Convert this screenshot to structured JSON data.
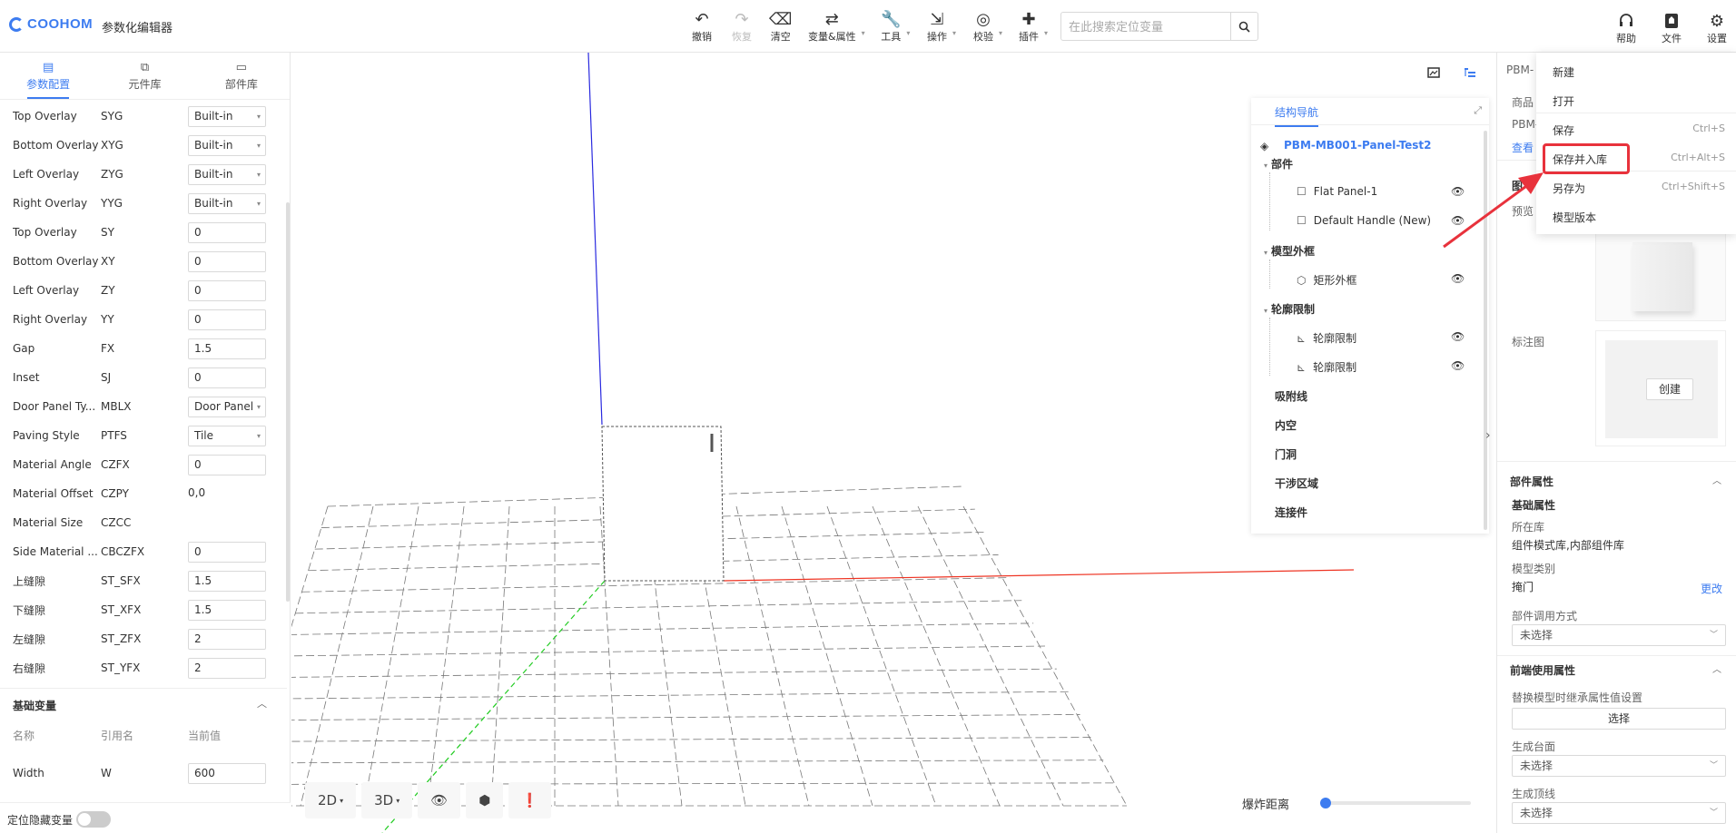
{
  "app": {
    "logo_text": "COOHOM",
    "title": "参数化编辑器"
  },
  "toolbar": {
    "items": [
      {
        "label": "撤销",
        "icon": "undo-icon"
      },
      {
        "label": "恢复",
        "icon": "redo-icon"
      },
      {
        "label": "清空",
        "icon": "eraser-icon"
      },
      {
        "label": "变量&属性",
        "icon": "variable-icon"
      },
      {
        "label": "工具",
        "icon": "wrench-icon"
      },
      {
        "label": "操作",
        "icon": "operate-icon"
      },
      {
        "label": "校验",
        "icon": "check-icon"
      },
      {
        "label": "插件",
        "icon": "plugin-icon"
      }
    ],
    "search_placeholder": "在此搜索定位变量",
    "right": [
      {
        "label": "帮助",
        "icon": "headset-icon"
      },
      {
        "label": "文件",
        "icon": "file-icon"
      },
      {
        "label": "设置",
        "icon": "gear-icon"
      }
    ]
  },
  "left_tabs": [
    {
      "label": "参数配置",
      "icon": "param-icon"
    },
    {
      "label": "元件库",
      "icon": "component-icon"
    },
    {
      "label": "部件库",
      "icon": "part-library-icon"
    }
  ],
  "params": [
    {
      "name": "Top Overlay",
      "code": "SYG",
      "value": "Built-in",
      "type": "select"
    },
    {
      "name": "Bottom Overlay",
      "code": "XYG",
      "value": "Built-in",
      "type": "select"
    },
    {
      "name": "Left Overlay",
      "code": "ZYG",
      "value": "Built-in",
      "type": "select"
    },
    {
      "name": "Right Overlay",
      "code": "YYG",
      "value": "Built-in",
      "type": "select"
    },
    {
      "name": "Top Overlay",
      "code": "SY",
      "value": "0",
      "type": "input"
    },
    {
      "name": "Bottom Overlay",
      "code": "XY",
      "value": "0",
      "type": "input"
    },
    {
      "name": "Left Overlay",
      "code": "ZY",
      "value": "0",
      "type": "input"
    },
    {
      "name": "Right Overlay",
      "code": "YY",
      "value": "0",
      "type": "input"
    },
    {
      "name": "Gap",
      "code": "FX",
      "value": "1.5",
      "type": "input"
    },
    {
      "name": "Inset",
      "code": "SJ",
      "value": "0",
      "type": "input"
    },
    {
      "name": "Door Panel Ty...",
      "code": "MBLX",
      "value": "Door Panel",
      "type": "select"
    },
    {
      "name": "Paving Style",
      "code": "PTFS",
      "value": "Tile",
      "type": "select"
    },
    {
      "name": "Material Angle",
      "code": "CZFX",
      "value": "0",
      "type": "input"
    },
    {
      "name": "Material Offset",
      "code": "CZPY",
      "value": "0,0",
      "type": "plain"
    },
    {
      "name": "Material Size",
      "code": "CZCC",
      "value": "",
      "type": "plain"
    },
    {
      "name": "Side Material ...",
      "code": "CBCZFX",
      "value": "0",
      "type": "input"
    },
    {
      "name": "上缝隙",
      "code": "ST_SFX",
      "value": "1.5",
      "type": "input"
    },
    {
      "name": "下缝隙",
      "code": "ST_XFX",
      "value": "1.5",
      "type": "input"
    },
    {
      "name": "左缝隙",
      "code": "ST_ZFX",
      "value": "2",
      "type": "input"
    },
    {
      "name": "右缝隙",
      "code": "ST_YFX",
      "value": "2",
      "type": "input"
    }
  ],
  "basic_vars": {
    "title": "基础变量",
    "headers": [
      "名称",
      "引用名",
      "当前值"
    ],
    "rows": [
      {
        "name": "Width",
        "code": "W",
        "value": "600"
      }
    ]
  },
  "hide_toggle_label": "定位隐藏变量",
  "viewport": {
    "bottom_buttons": [
      "2D",
      "3D"
    ],
    "explode_label": "爆炸距离",
    "explode_value": 0
  },
  "structure_nav": {
    "title": "结构导航",
    "root": "PBM-MB001-Panel-Test2",
    "groups": [
      {
        "label": "部件",
        "children": [
          "Flat Panel-1",
          "Default Handle (New)"
        ]
      },
      {
        "label": "模型外框",
        "children": [
          "矩形外框"
        ]
      },
      {
        "label": "轮廓限制",
        "children": [
          "轮廓限制",
          "轮廓限制"
        ]
      }
    ],
    "others": [
      "吸附线",
      "内空",
      "门洞",
      "干涉区域",
      "连接件"
    ]
  },
  "right_panel": {
    "code_prefix": "PBM-",
    "product_label": "商品",
    "product_prefix": "PBM-",
    "view_link": "查看",
    "section_prefix": "图",
    "preview_label": "预览",
    "label_image": "标注图",
    "create_button": "创建",
    "part_props_title": "部件属性",
    "basic_props": "基础属性",
    "library_label": "所在库",
    "library_value": "组件模式库,内部组件库",
    "model_type_label": "模型类别",
    "model_type_value": "掩门",
    "change_link": "更改",
    "call_mode_label": "部件调用方式",
    "call_mode_value": "未选择",
    "frontend_title": "前端使用属性",
    "inherit_label": "替换模型时继承属性值设置",
    "select_button": "选择",
    "gen_top_label": "生成台面",
    "gen_top_value": "未选择",
    "gen_line_label": "生成顶线",
    "gen_line_value": "未选择"
  },
  "file_menu": {
    "items": [
      {
        "label": "新建",
        "shortcut": ""
      },
      {
        "label": "打开",
        "shortcut": ""
      },
      {
        "label": "保存",
        "shortcut": "Ctrl+S"
      },
      {
        "label": "保存并入库",
        "shortcut": "Ctrl+Alt+S"
      },
      {
        "label": "另存为",
        "shortcut": "Ctrl+Shift+S"
      },
      {
        "label": "模型版本",
        "shortcut": ""
      }
    ]
  },
  "colors": {
    "accent": "#3d7cf0",
    "highlight": "#e8323c"
  }
}
